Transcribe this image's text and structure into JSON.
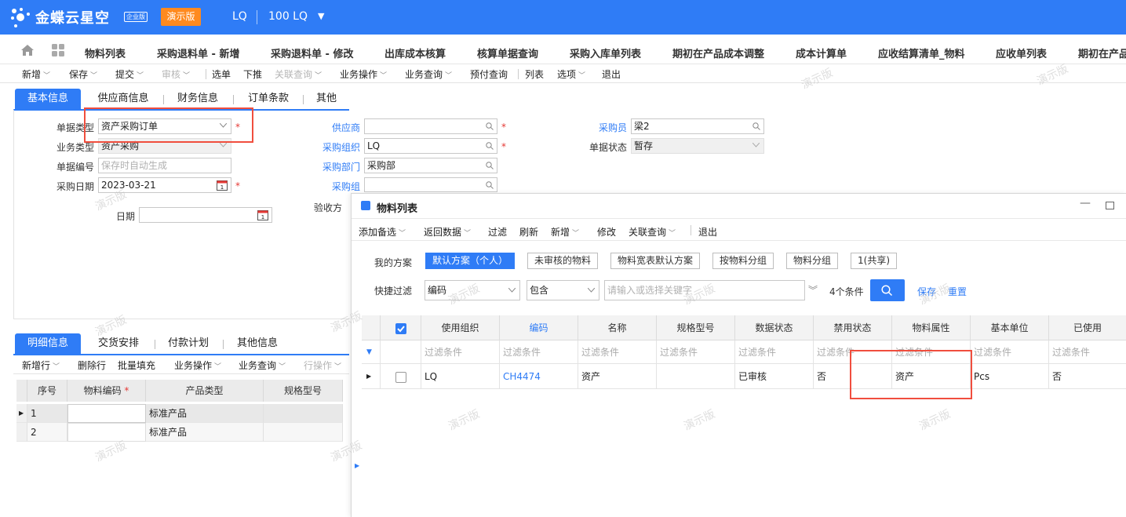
{
  "app": {
    "logo_text": "金蝶云星空",
    "logo_badge": "企业版",
    "demo_button": "演示版",
    "org": "LQ",
    "database": "100 LQ"
  },
  "nav_tabs": [
    "物料列表",
    "采购退料单 - 新增",
    "采购退料单 - 修改",
    "出库成本核算",
    "核算单据查询",
    "采购入库单列表",
    "期初在产品成本调整",
    "成本计算单",
    "应收结算清单_物料",
    "应收单列表",
    "期初在产品"
  ],
  "toolbar": {
    "new": "新增",
    "save": "保存",
    "submit": "提交",
    "audit": "审核",
    "select_doc": "选单",
    "push": "下推",
    "linked_query": "关联查询",
    "business_ops": "业务操作",
    "business_query": "业务查询",
    "prepay_query": "预付查询",
    "list": "列表",
    "options": "选项",
    "exit": "退出"
  },
  "header_tabs": [
    "基本信息",
    "供应商信息",
    "财务信息",
    "订单条款",
    "其他"
  ],
  "form": {
    "doc_type_label": "单据类型",
    "doc_type_value": "资产采购订单",
    "biz_type_label": "业务类型",
    "biz_type_value": "资产采购",
    "doc_no_label": "单据编号",
    "doc_no_placeholder": "保存时自动生成",
    "purchase_date_label": "采购日期",
    "purchase_date_value": "2023-03-21",
    "date_label": "日期",
    "supplier_label": "供应商",
    "purchase_org_label": "采购组织",
    "purchase_org_value": "LQ",
    "purchase_dept_label": "采购部门",
    "purchase_dept_value": "采购部",
    "purchase_group_label": "采购组",
    "acceptance_label": "验收方",
    "buyer_label": "采购员",
    "buyer_value": "梁2",
    "doc_status_label": "单据状态",
    "doc_status_value": "暂存"
  },
  "detail_tabs": [
    "明细信息",
    "交货安排",
    "付款计划",
    "其他信息"
  ],
  "detail_toolbar": {
    "add_row": "新增行",
    "delete_row": "删除行",
    "batch_fill": "批量填充",
    "business_ops": "业务操作",
    "business_query": "业务查询",
    "row_ops": "行操作"
  },
  "detail_grid": {
    "columns": [
      "序号",
      "物料编码",
      "产品类型",
      "规格型号"
    ],
    "rows": [
      {
        "seq": "1",
        "code": "",
        "product_type": "标准产品",
        "spec": ""
      },
      {
        "seq": "2",
        "code": "",
        "product_type": "标准产品",
        "spec": ""
      }
    ]
  },
  "dialog": {
    "title": "物料列表",
    "toolbar": {
      "add_candidate": "添加备选",
      "return_data": "返回数据",
      "filter": "过滤",
      "refresh": "刷新",
      "new": "新增",
      "edit": "修改",
      "linked_query": "关联查询",
      "exit": "退出"
    },
    "scheme_label": "我的方案",
    "schemes": [
      "默认方案（个人）",
      "未审核的物料",
      "物料宽表默认方案",
      "按物料分组",
      "物料分组",
      "1(共享)"
    ],
    "quick_filter_label": "快捷过滤",
    "filter_field": "编码",
    "filter_op": "包含",
    "filter_placeholder": "请输入或选择关键字",
    "conditions": "4个条件",
    "save": "保存",
    "reset": "重置",
    "columns": [
      "使用组织",
      "编码",
      "名称",
      "规格型号",
      "数据状态",
      "禁用状态",
      "物料属性",
      "基本单位",
      "已使用"
    ],
    "filter_cell": "过滤条件",
    "rows": [
      {
        "org": "LQ",
        "code": "CH4474",
        "name": "资产",
        "spec": "",
        "data_status": "已审核",
        "disabled": "否",
        "attr": "资产",
        "unit": "Pcs",
        "used": "否"
      }
    ]
  },
  "watermark": "演示版",
  "colors": {
    "brand": "#2f7cf6",
    "demo": "#ff8a1f",
    "highlight": "#f04e3e",
    "required": "#e53935"
  }
}
